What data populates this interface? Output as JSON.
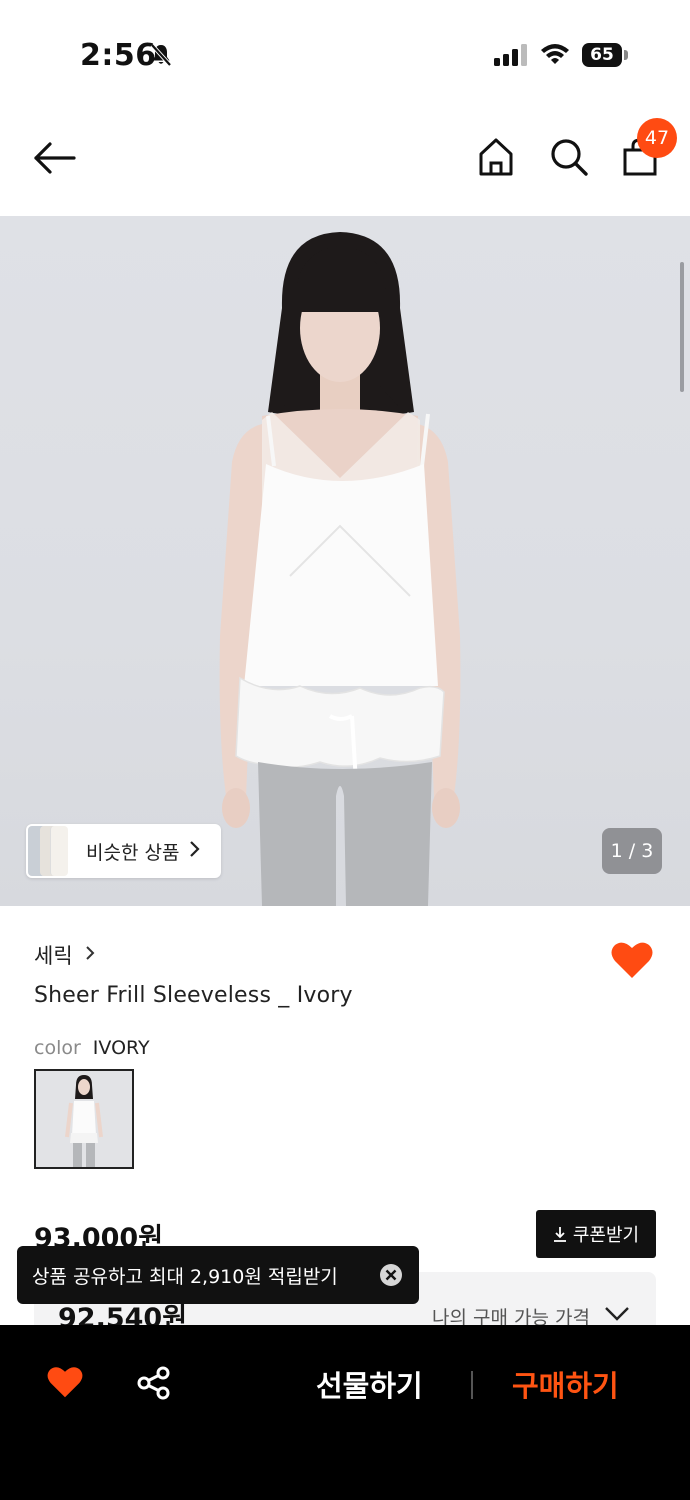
{
  "status_bar": {
    "time": "2:56",
    "battery": "65"
  },
  "nav": {
    "cart_count": "47"
  },
  "hero": {
    "similar_label": "비슷한 상품",
    "page_indicator": "1 / 3"
  },
  "product": {
    "brand": "세릭",
    "title": "Sheer Frill Sleeveless _ Ivory",
    "color_label": "color",
    "color_value": "IVORY",
    "price": "93,000원",
    "coupon_label": "쿠폰받기",
    "final_price": "92,540원",
    "my_price_label": "나의 구매 가능 가격"
  },
  "toast": {
    "text": "상품 공유하고 최대 2,910원 적립받기"
  },
  "bottom_bar": {
    "gift_label": "선물하기",
    "buy_label": "구매하기"
  },
  "colors": {
    "accent": "#ff4b12",
    "buy_text": "#ff5412",
    "dark": "#111111"
  }
}
